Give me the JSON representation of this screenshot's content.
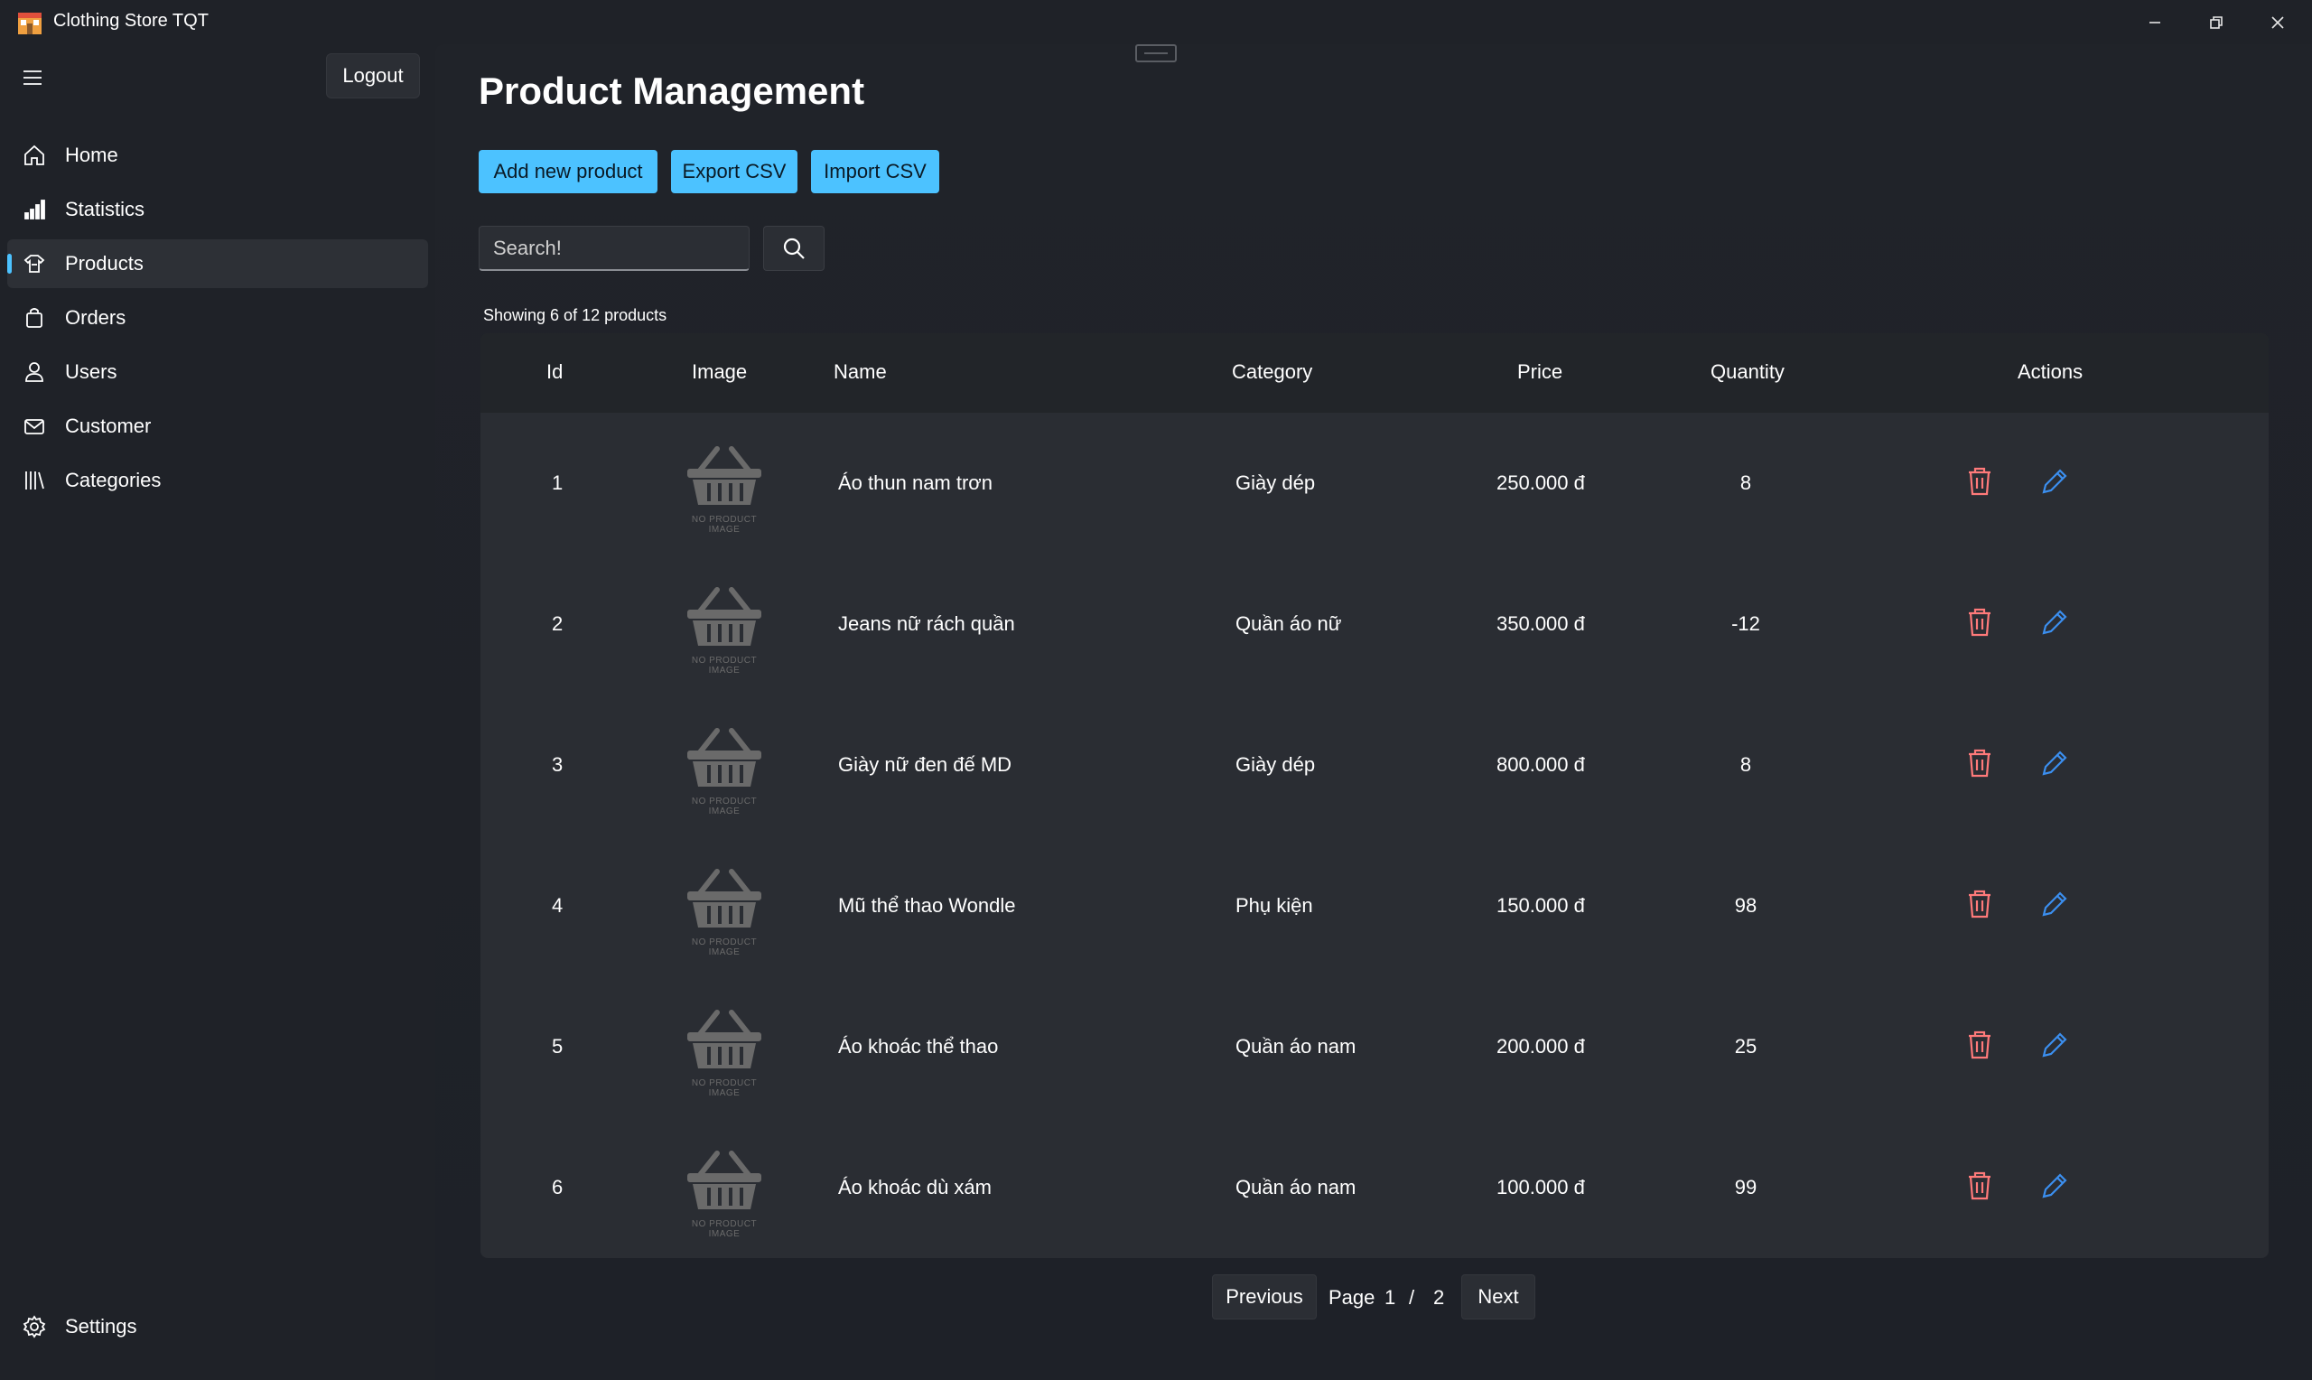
{
  "window": {
    "title": "Clothing Store TQT",
    "controls": [
      "minimize-icon",
      "restore-icon",
      "close-icon"
    ]
  },
  "sidebar": {
    "logout_label": "Logout",
    "items": [
      {
        "label": "Home",
        "icon": "home-icon"
      },
      {
        "label": "Statistics",
        "icon": "bar-chart-icon"
      },
      {
        "label": "Products",
        "icon": "products-icon",
        "active": true
      },
      {
        "label": "Orders",
        "icon": "shopping-bag-icon"
      },
      {
        "label": "Users",
        "icon": "user-icon"
      },
      {
        "label": "Customer",
        "icon": "mail-icon"
      },
      {
        "label": "Categories",
        "icon": "library-icon"
      }
    ],
    "settings_label": "Settings"
  },
  "main": {
    "title": "Product Management",
    "buttons": {
      "add": "Add new product",
      "export": "Export CSV",
      "import": "Import CSV"
    },
    "search": {
      "placeholder": "Search!"
    },
    "showing": "Showing 6 of 12 products",
    "table": {
      "headers": [
        "Id",
        "Image",
        "Name",
        "Category",
        "Price",
        "Quantity",
        "Actions"
      ],
      "image_placeholder_text": "NO PRODUCT IMAGE",
      "rows": [
        {
          "id": "1",
          "name": "Áo thun nam trơn",
          "category": "Giày dép",
          "price": "250.000 đ",
          "quantity": "8"
        },
        {
          "id": "2",
          "name": "Jeans nữ rách quần",
          "category": "Quần áo nữ",
          "price": "350.000 đ",
          "quantity": "-12"
        },
        {
          "id": "3",
          "name": "Giày nữ đen đế MD",
          "category": "Giày dép",
          "price": "800.000 đ",
          "quantity": "8"
        },
        {
          "id": "4",
          "name": "Mũ thể thao Wondle",
          "category": "Phụ kiện",
          "price": "150.000 đ",
          "quantity": "98"
        },
        {
          "id": "5",
          "name": "Áo khoác thể thao",
          "category": "Quần áo nam",
          "price": "200.000 đ",
          "quantity": "25"
        },
        {
          "id": "6",
          "name": "Áo khoác dù xám",
          "category": "Quần áo nam",
          "price": "100.000 đ",
          "quantity": "99"
        }
      ]
    },
    "pagination": {
      "previous": "Previous",
      "page_label": "Page",
      "current": "1",
      "separator": "/",
      "total": "2",
      "next": "Next"
    }
  },
  "colors": {
    "accent": "#4cc2ff",
    "delete": "#ff7a7a",
    "edit": "#3b8ff0"
  }
}
